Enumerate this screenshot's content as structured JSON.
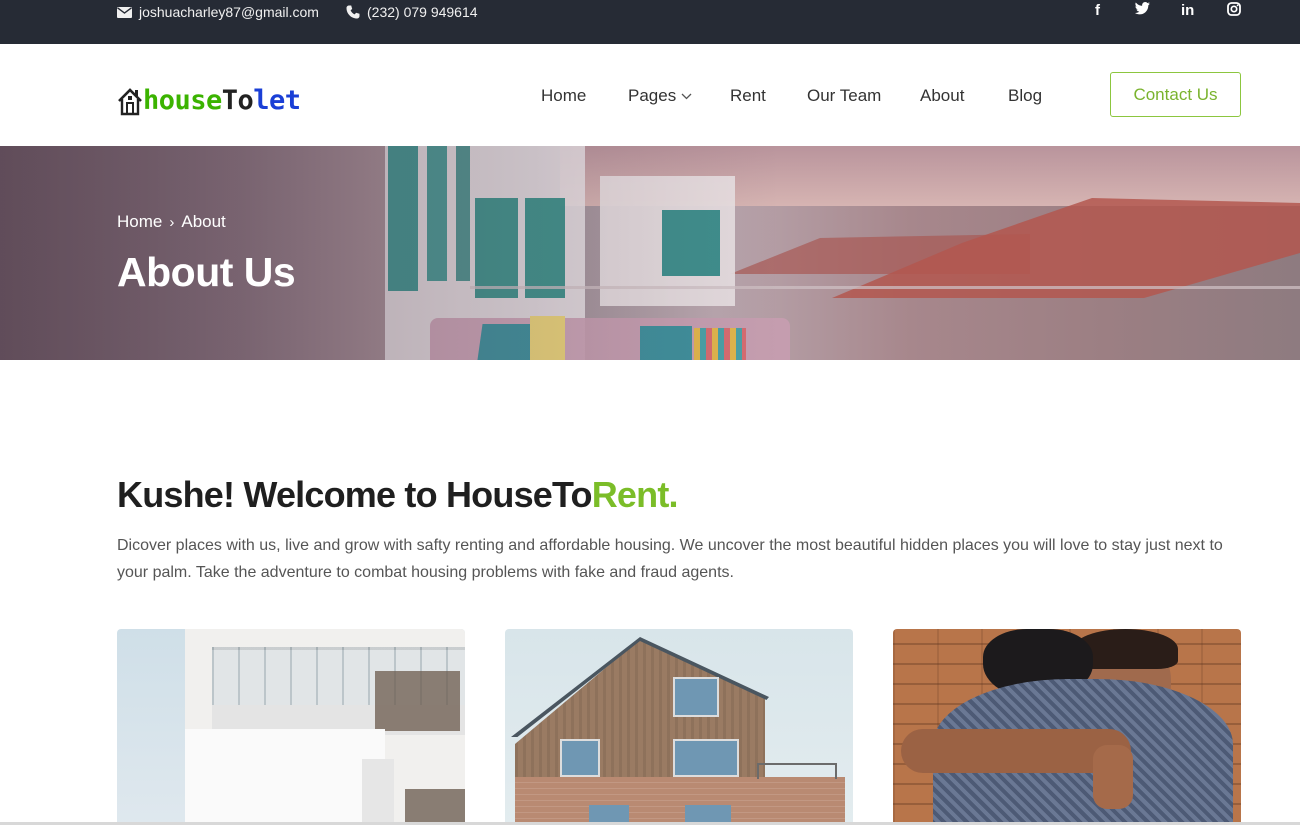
{
  "topbar": {
    "email": "joshuacharley87@gmail.com",
    "phone": "(232) 079 949614",
    "social_icons": [
      "facebook-icon",
      "twitter-icon",
      "linkedin-icon",
      "instagram-icon"
    ],
    "social_glyphs": {
      "facebook": "f",
      "twitter": "t",
      "linkedin": "in",
      "instagram": "◎"
    }
  },
  "header": {
    "logo": {
      "part1": "house",
      "part2": "To",
      "part3": "let"
    },
    "nav": {
      "home": "Home",
      "pages": "Pages",
      "rent": "Rent",
      "team": "Our Team",
      "about": "About",
      "blog": "Blog"
    },
    "contact_button": "Contact Us"
  },
  "hero": {
    "breadcrumb": {
      "home": "Home",
      "separator": "›",
      "current": "About"
    },
    "title": "About Us"
  },
  "welcome": {
    "title_main": "Kushe! Welcome to HouseTo",
    "title_accent": "Rent.",
    "description": "Dicover places with us, live and grow with safty renting and affordable housing. We uncover the most beautiful hidden places you will love to stay just next to your palm. Take the adventure to combat housing problems with fake and fraud agents."
  },
  "colors": {
    "topbar_bg": "#262b35",
    "accent_green": "#7bbd28",
    "button_border": "#8cc63f",
    "logo_green": "#3bb300",
    "logo_blue": "#1a3fd6"
  }
}
